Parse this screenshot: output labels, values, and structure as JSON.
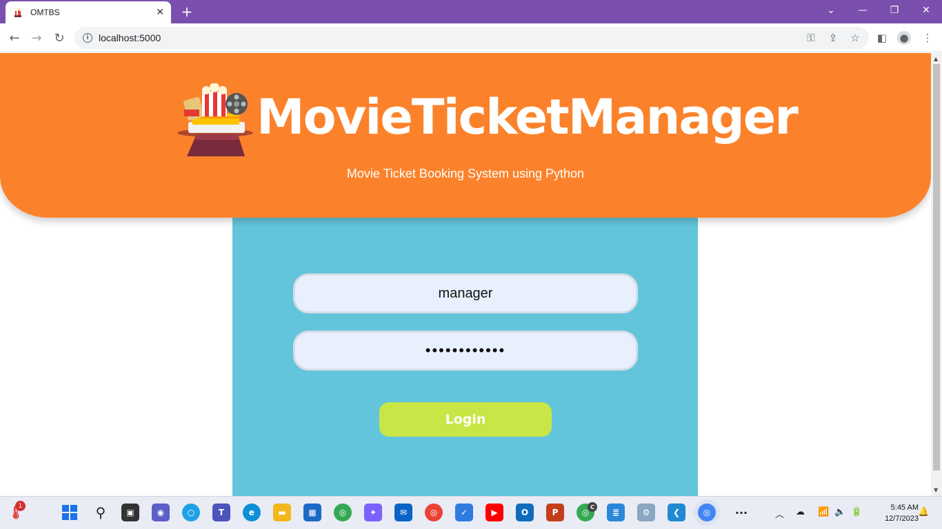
{
  "browser": {
    "tab_title": "OMTBS",
    "url": "localhost:5000"
  },
  "header": {
    "brand": "MovieTicketManager",
    "subtitle": "Movie Ticket Booking System using Python"
  },
  "form": {
    "username_value": "manager",
    "password_value": "••••••••••••",
    "login_label": "Login"
  },
  "taskbar": {
    "time": "5:45 AM",
    "date": "12/7/2023",
    "weather_badge": "1",
    "chrome_badge": "C"
  },
  "colors": {
    "header": "#fb822b",
    "card": "#63c5db",
    "login_button": "#c8e645",
    "tab_strip": "#7b4fae"
  }
}
